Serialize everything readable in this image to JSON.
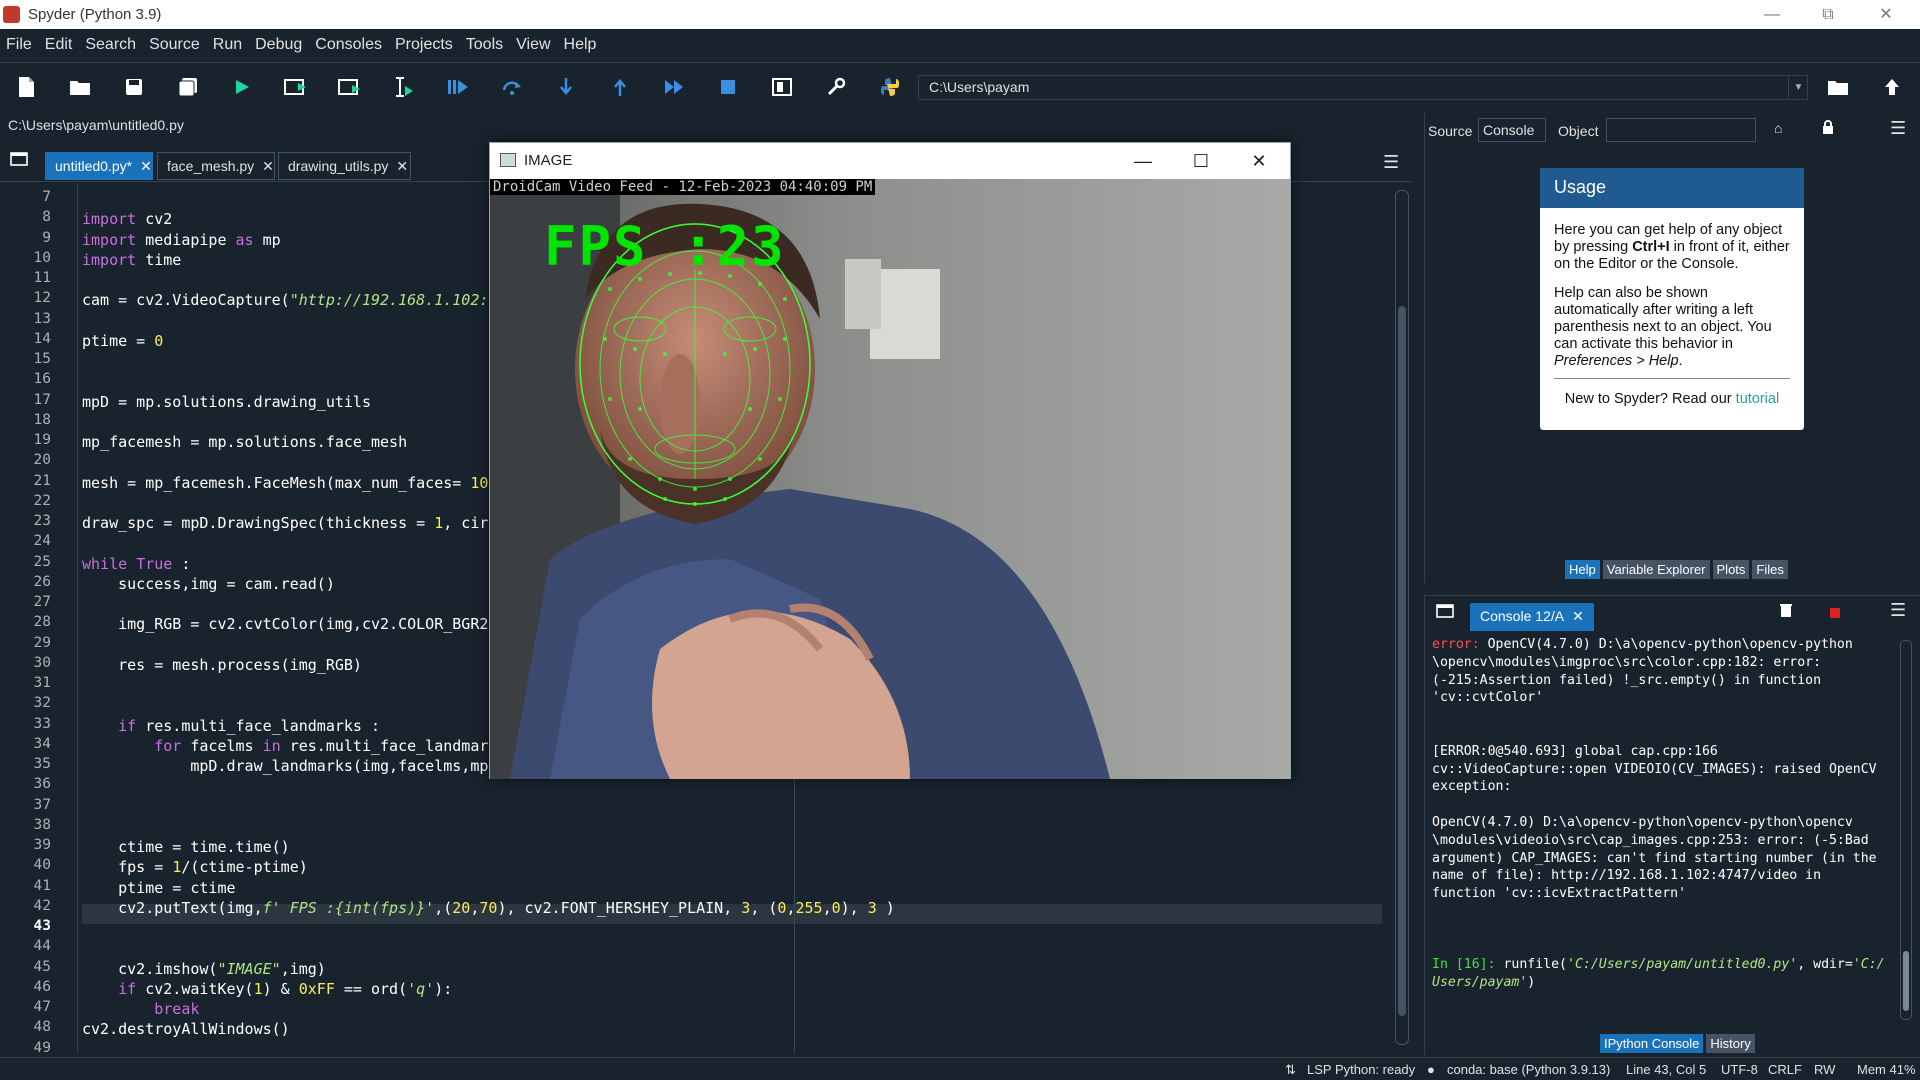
{
  "window": {
    "title": "Spyder (Python 3.9)"
  },
  "menu": [
    "File",
    "Edit",
    "Search",
    "Source",
    "Run",
    "Debug",
    "Consoles",
    "Projects",
    "Tools",
    "View",
    "Help"
  ],
  "toolbar": {
    "path": "C:\\Users\\payam"
  },
  "editor": {
    "filepath": "C:\\Users\\payam\\untitled0.py",
    "tabs": [
      {
        "label": "untitled0.py*",
        "active": true
      },
      {
        "label": "face_mesh.py",
        "active": false
      },
      {
        "label": "drawing_utils.py",
        "active": false
      }
    ],
    "current_line": 43,
    "lines": [
      {
        "n": 7,
        "html": ""
      },
      {
        "n": 8,
        "html": "<span class='kw'>import</span> cv2"
      },
      {
        "n": 9,
        "html": "<span class='kw'>import</span> mediapipe <span class='kw'>as</span> mp"
      },
      {
        "n": 10,
        "html": "<span class='kw'>import</span> time"
      },
      {
        "n": 11,
        "html": ""
      },
      {
        "n": 12,
        "html": "cam = cv2.VideoCapture(<span class='st'>\"http://192.168.1.102:</span>"
      },
      {
        "n": 13,
        "html": ""
      },
      {
        "n": 14,
        "html": "ptime = <span class='nm'>0</span>"
      },
      {
        "n": 15,
        "html": ""
      },
      {
        "n": 16,
        "html": ""
      },
      {
        "n": 17,
        "html": "mpD = mp.solutions.drawing_utils"
      },
      {
        "n": 18,
        "html": ""
      },
      {
        "n": 19,
        "html": "mp_facemesh = mp.solutions.face_mesh"
      },
      {
        "n": 20,
        "html": ""
      },
      {
        "n": 21,
        "html": "mesh = mp_facemesh.FaceMesh(max_num_faces= <span class='nm'>10</span>"
      },
      {
        "n": 22,
        "html": ""
      },
      {
        "n": 23,
        "html": "draw_spc = mpD.DrawingSpec(thickness = <span class='nm'>1</span>, cir"
      },
      {
        "n": 24,
        "html": ""
      },
      {
        "n": 25,
        "html": "<span class='kw'>while</span> <span class='kw'>True</span> :"
      },
      {
        "n": 26,
        "html": "    success,img = cam.read()"
      },
      {
        "n": 27,
        "html": ""
      },
      {
        "n": 28,
        "html": "    img_RGB = cv2.cvtColor(img,cv2.COLOR_BGR2"
      },
      {
        "n": 29,
        "html": ""
      },
      {
        "n": 30,
        "html": "    res = mesh.process(img_RGB)"
      },
      {
        "n": 31,
        "html": ""
      },
      {
        "n": 32,
        "html": ""
      },
      {
        "n": 33,
        "html": "    <span class='kw'>if</span> res.multi_face_landmarks :"
      },
      {
        "n": 34,
        "html": "        <span class='kw'>for</span> facelms <span class='kw'>in</span> res.multi_face_landmar"
      },
      {
        "n": 35,
        "html": "            mpD.draw_landmarks(img,facelms,mp"
      },
      {
        "n": 36,
        "html": ""
      },
      {
        "n": 37,
        "html": ""
      },
      {
        "n": 38,
        "html": ""
      },
      {
        "n": 39,
        "html": "    ctime = time.time()"
      },
      {
        "n": 40,
        "html": "    fps = <span class='nm'>1</span>/(ctime-ptime)"
      },
      {
        "n": 41,
        "html": "    ptime = ctime"
      },
      {
        "n": 42,
        "html": "    cv2.putText(img,<span class='st'>f' FPS :{int(fps)}'</span>,(<span class='nm'>20</span>,<span class='nm'>70</span>), cv2.FONT_HERSHEY_PLAIN, <span class='nm'>3</span>, (<span class='nm'>0</span>,<span class='nm'>255</span>,<span class='nm'>0</span>), <span class='nm'>3</span> )"
      },
      {
        "n": 43,
        "html": ""
      },
      {
        "n": 44,
        "html": ""
      },
      {
        "n": 45,
        "html": "    cv2.imshow(<span class='st'>\"IMAGE\"</span>,img)"
      },
      {
        "n": 46,
        "html": "    <span class='kw'>if</span> cv2.waitKey(<span class='nm'>1</span>) &amp; <span class='nm'>0xFF</span> == ord(<span class='st'>'q'</span>):"
      },
      {
        "n": 47,
        "html": "        <span class='kw'>break</span>"
      },
      {
        "n": 48,
        "html": "cv2.destroyAllWindows()"
      },
      {
        "n": 49,
        "html": ""
      }
    ]
  },
  "image_window": {
    "title": "IMAGE",
    "overlay": "DroidCam Video Feed - 12-Feb-2023 04:40:09 PM",
    "fps": "FPS :23"
  },
  "help": {
    "source_label": "Source",
    "source_value": "Console",
    "object_label": "Object",
    "usage_title": "Usage",
    "p1": "Here you can get help of any object by pressing <b>Ctrl+I</b> in front of it, either on the Editor or the Console.",
    "p2": "Help can also be shown automatically after writing a left parenthesis next to an object. You can activate this behavior in <i>Preferences &gt; Help</i>.",
    "tutorial_prefix": "New to Spyder? Read our ",
    "tutorial_link": "tutorial",
    "tabs": [
      "Help",
      "Variable Explorer",
      "Plots",
      "Files"
    ]
  },
  "console": {
    "tab": "Console 12/A",
    "output_html": "<span class='err'>error: </span>OpenCV(4.7.0) D:\\a\\opencv-python\\opencv-python\n\\opencv\\modules\\imgproc\\src\\color.cpp:182: error:\n(-215:Assertion failed) !_src.empty() in function\n'cv::cvtColor'\n\n\n[ERROR:0@540.693] global cap.cpp:166\ncv::VideoCapture::open VIDEOIO(CV_IMAGES): raised OpenCV\nexception:\n\nOpenCV(4.7.0) D:\\a\\opencv-python\\opencv-python\\opencv\n\\modules\\videoio\\src\\cap_images.cpp:253: error: (-5:Bad\nargument) CAP_IMAGES: can't find starting number (in the\nname of file): http://192.168.1.102:4747/video in\nfunction 'cv::icvExtractPattern'\n\n\n\n<span class='prompt'>In [16]:</span> runfile(<span class='it'>'C:/Users/payam/untitled0.py'</span>, wdir=<span class='it'>'C:/\nUsers/payam'</span>)",
    "tabs": [
      "IPython Console",
      "History"
    ]
  },
  "status": {
    "lsp": "LSP Python: ready",
    "conda": "conda: base (Python 3.9.13)",
    "position": "Line 43, Col 5",
    "encoding": "UTF-8",
    "eol": "CRLF",
    "rw": "RW",
    "mem": "Mem 41%"
  },
  "colors": {
    "accent": "#1a72bb",
    "background": "#19232d",
    "fps_green": "#00e600"
  }
}
